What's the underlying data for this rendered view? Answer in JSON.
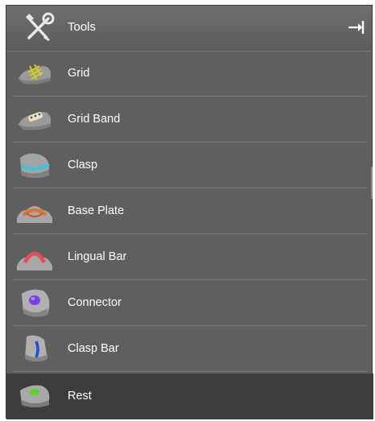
{
  "header": {
    "title": "Tools",
    "icon": "tools-icon",
    "pin_icon": "pin-icon"
  },
  "items": [
    {
      "label": "Grid",
      "icon": "grid-icon",
      "color": "#c8c020"
    },
    {
      "label": "Grid Band",
      "icon": "grid-band-icon",
      "color": "#e0d8b0"
    },
    {
      "label": "Clasp",
      "icon": "clasp-icon",
      "color": "#40c0d8"
    },
    {
      "label": "Base Plate",
      "icon": "base-plate-icon",
      "color": "#e07030"
    },
    {
      "label": "Lingual Bar",
      "icon": "lingual-bar-icon",
      "color": "#e05060"
    },
    {
      "label": "Connector",
      "icon": "connector-icon",
      "color": "#7a40e0"
    },
    {
      "label": "Clasp Bar",
      "icon": "clasp-bar-icon",
      "color": "#2050d0"
    },
    {
      "label": "Rest",
      "icon": "rest-icon",
      "color": "#60d030",
      "selected": true
    }
  ]
}
